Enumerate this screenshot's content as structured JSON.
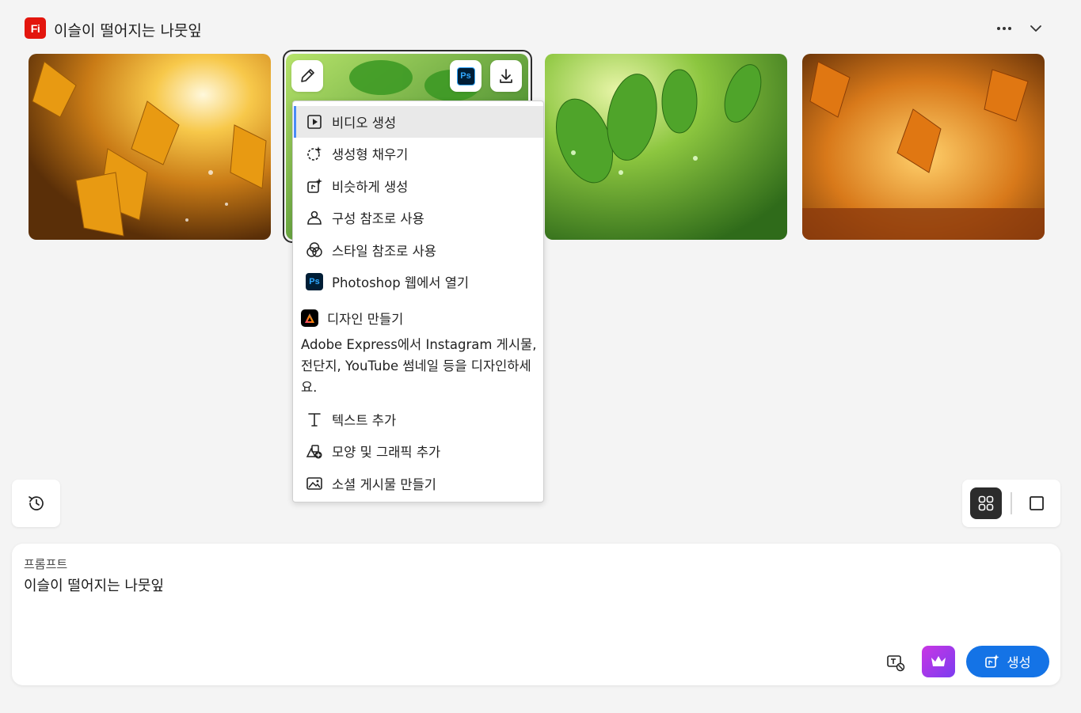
{
  "header": {
    "app_badge": "Fi",
    "title": "이슬이 떨어지는 나뭇잎",
    "more_icon": "ellipsis-icon",
    "collapse_icon": "chevron-down-icon"
  },
  "thumbnail_tools": {
    "edit_icon": "pencil-icon",
    "ps_label": "Ps",
    "download_icon": "download-icon"
  },
  "menu": {
    "items": [
      {
        "label": "비디오 생성",
        "icon": "play-video-icon",
        "active": true
      },
      {
        "label": "생성형 채우기",
        "icon": "generative-fill-icon"
      },
      {
        "label": "비슷하게 생성",
        "icon": "generate-similar-icon"
      },
      {
        "label": "구성 참조로 사용",
        "icon": "composition-reference-icon"
      },
      {
        "label": "스타일 참조로 사용",
        "icon": "style-reference-icon"
      },
      {
        "label": "Photoshop 웹에서 열기",
        "icon": "photoshop-icon",
        "badge": "Ps"
      }
    ],
    "design": {
      "title": "디자인 만들기",
      "description": "Adobe Express에서 Instagram 게시물, 전단지, YouTube 썸네일 등을 디자인하세요."
    },
    "items_bottom": [
      {
        "label": "텍스트 추가",
        "icon": "text-icon"
      },
      {
        "label": "모양 및 그래픽 추가",
        "icon": "shapes-add-icon"
      },
      {
        "label": "소셜 게시물 만들기",
        "icon": "image-post-icon"
      }
    ]
  },
  "controls": {
    "history_icon": "history-icon",
    "grid_view_icon": "grid-view-icon",
    "single_view_icon": "single-view-icon"
  },
  "prompt": {
    "label": "프롬프트",
    "value": "이슬이 떨어지는 나뭇잎",
    "generate_label": "생성"
  },
  "colors": {
    "brand_red": "#e3150d",
    "accent_blue": "#1473e6",
    "premium_gradient_start": "#c936e4",
    "premium_gradient_end": "#7b3cf0"
  }
}
